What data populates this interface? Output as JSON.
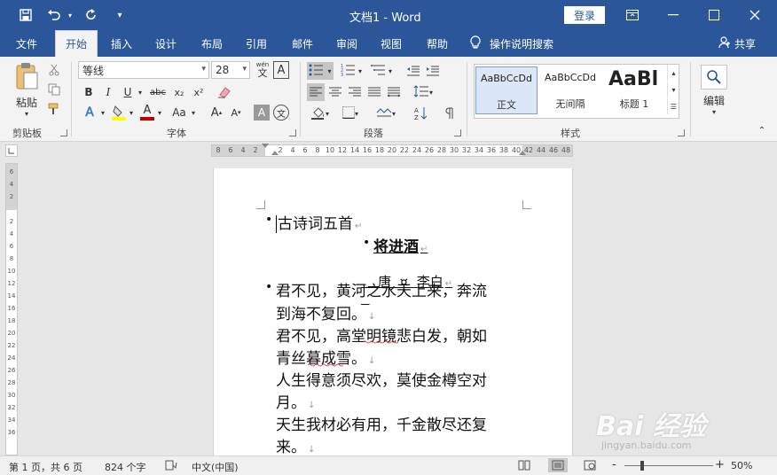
{
  "window": {
    "doc_name": "文档1",
    "separator": " - ",
    "app_name": "Word",
    "login": "登录"
  },
  "tabs": [
    "文件",
    "开始",
    "插入",
    "设计",
    "布局",
    "引用",
    "邮件",
    "审阅",
    "视图",
    "帮助"
  ],
  "active_tab": "开始",
  "tell_me": "操作说明搜索",
  "share": "共享",
  "ribbon": {
    "clipboard": {
      "paste": "粘贴",
      "label": "剪贴板"
    },
    "font": {
      "name": "等线",
      "size": "28",
      "wen_top": "wén",
      "wen_glyph": "文",
      "a_glyph": "A",
      "bold": "B",
      "italic": "I",
      "underline": "U",
      "strike": "abc",
      "sub": "x₂",
      "sup": "x²",
      "grow": "A",
      "shrink": "A",
      "case": "Aa",
      "label": "字体"
    },
    "paragraph": {
      "label": "段落"
    },
    "styles": {
      "items": [
        {
          "sample": "AaBbCcDd",
          "name": "正文"
        },
        {
          "sample": "AaBbCcDd",
          "name": "无间隔"
        },
        {
          "sample": "AaBl",
          "name": "标题 1"
        }
      ],
      "label": "样式"
    },
    "editing": {
      "label": "编辑"
    }
  },
  "ruler": {
    "h_ticks": [
      "8",
      "6",
      "4",
      "2",
      "",
      "2",
      "4",
      "6",
      "8",
      "10",
      "12",
      "14",
      "16",
      "18",
      "20",
      "22",
      "24",
      "26",
      "28",
      "30",
      "32",
      "34",
      "36",
      "38",
      "40",
      "42",
      "44",
      "46",
      "48"
    ],
    "v_ticks": [
      "6",
      "4",
      "2",
      "",
      "2",
      "4",
      "6",
      "8",
      "10",
      "12",
      "14",
      "16",
      "18",
      "20",
      "22",
      "24",
      "26",
      "28",
      "30",
      "32",
      "34",
      "36"
    ]
  },
  "document": {
    "line1": "古诗词五首",
    "title": "将进酒",
    "author": "唐  ¤  李白",
    "poem_lines": [
      "君不见，黄河之水天上来，奔流",
      "到海不复回。",
      "君不见，高堂明镜悲白发，朝如",
      "青丝暮成雪。",
      "人生得意须尽欢，莫使金樽空对",
      "月。",
      "天生我材必有用，千金散尽还复",
      "来。"
    ],
    "bullet": "•",
    "para_mark": "↵",
    "line_break": "↓"
  },
  "statusbar": {
    "page": "第 1 页，共 6 页",
    "words": "824 个字",
    "language": "中文(中国)",
    "zoom": "50%",
    "zoom_minus": "-",
    "zoom_plus": "+"
  },
  "watermark": {
    "brand": "Bai 经验",
    "url": "jingyan.baidu.com"
  },
  "colors": {
    "title_bar": "#2b579a",
    "ribbon_bg": "#f3f3f3",
    "highlight": "#ffff00",
    "font_color": "#c00000"
  }
}
